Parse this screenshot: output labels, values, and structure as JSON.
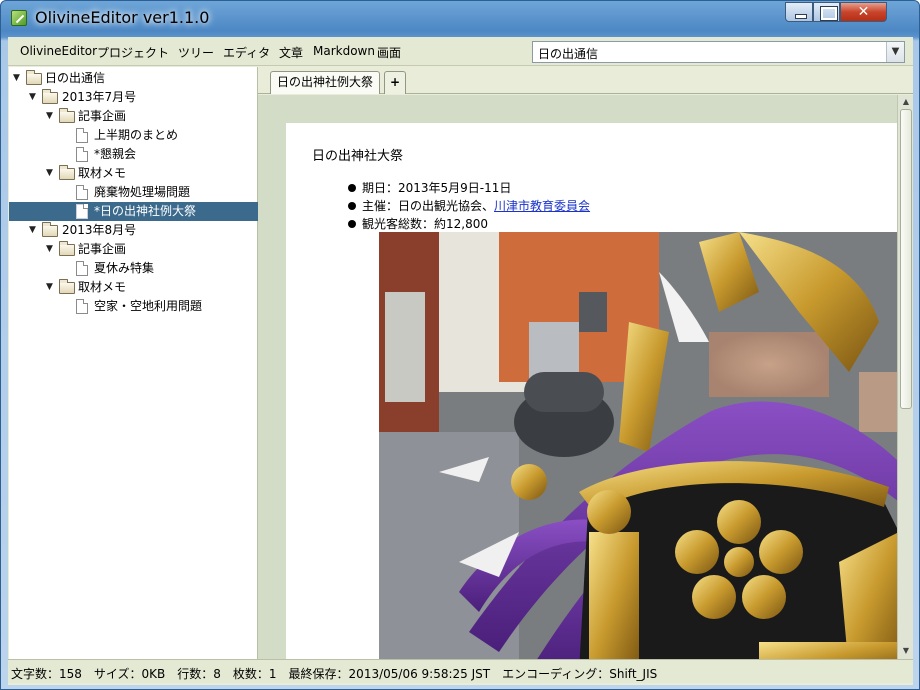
{
  "window": {
    "title": "OlivineEditor ver1.1.0",
    "close_glyph": "✕"
  },
  "menu": {
    "items": [
      "OlivineEditor",
      "プロジェクト",
      "ツリー",
      "エディタ",
      "文章",
      "Markdown",
      "画面"
    ],
    "project_selected": "日の出通信",
    "dropdown_icon": "chevron-down-icon"
  },
  "tree": {
    "root": "日の出通信",
    "nodes": [
      {
        "label": "2013年7月号"
      },
      {
        "label": "記事企画"
      },
      {
        "label": "上半期のまとめ"
      },
      {
        "label": "*懇親会"
      },
      {
        "label": "取材メモ"
      },
      {
        "label": "廃棄物処理場問題"
      },
      {
        "label": "*日の出神社例大祭"
      },
      {
        "label": "2013年8月号"
      },
      {
        "label": "記事企画"
      },
      {
        "label": "夏休み特集"
      },
      {
        "label": "取材メモ"
      },
      {
        "label": "空家・空地利用問題"
      }
    ]
  },
  "editor": {
    "active_tab": "日の出神社例大祭",
    "add_tab": "+",
    "doc_title": "日の出神社大祭",
    "bullets": {
      "date": "期日：2013年5月9日-11日",
      "host_prefix": "主催：日の出観光協会、",
      "host_link": "川津市教育委員会",
      "visitors": "観光客総数：約12,800"
    },
    "image_alt": "mikoshi-photo"
  },
  "status": {
    "text": "文字数：158　サイズ：0KB　行数：8　枚数：1　最終保存：2013/05/06 9:58:25 JST　エンコーディング：Shift_JIS"
  },
  "colors": {
    "selection": "#3b6a8c",
    "link": "#1a33c9",
    "panel": "#e8ecd9"
  }
}
